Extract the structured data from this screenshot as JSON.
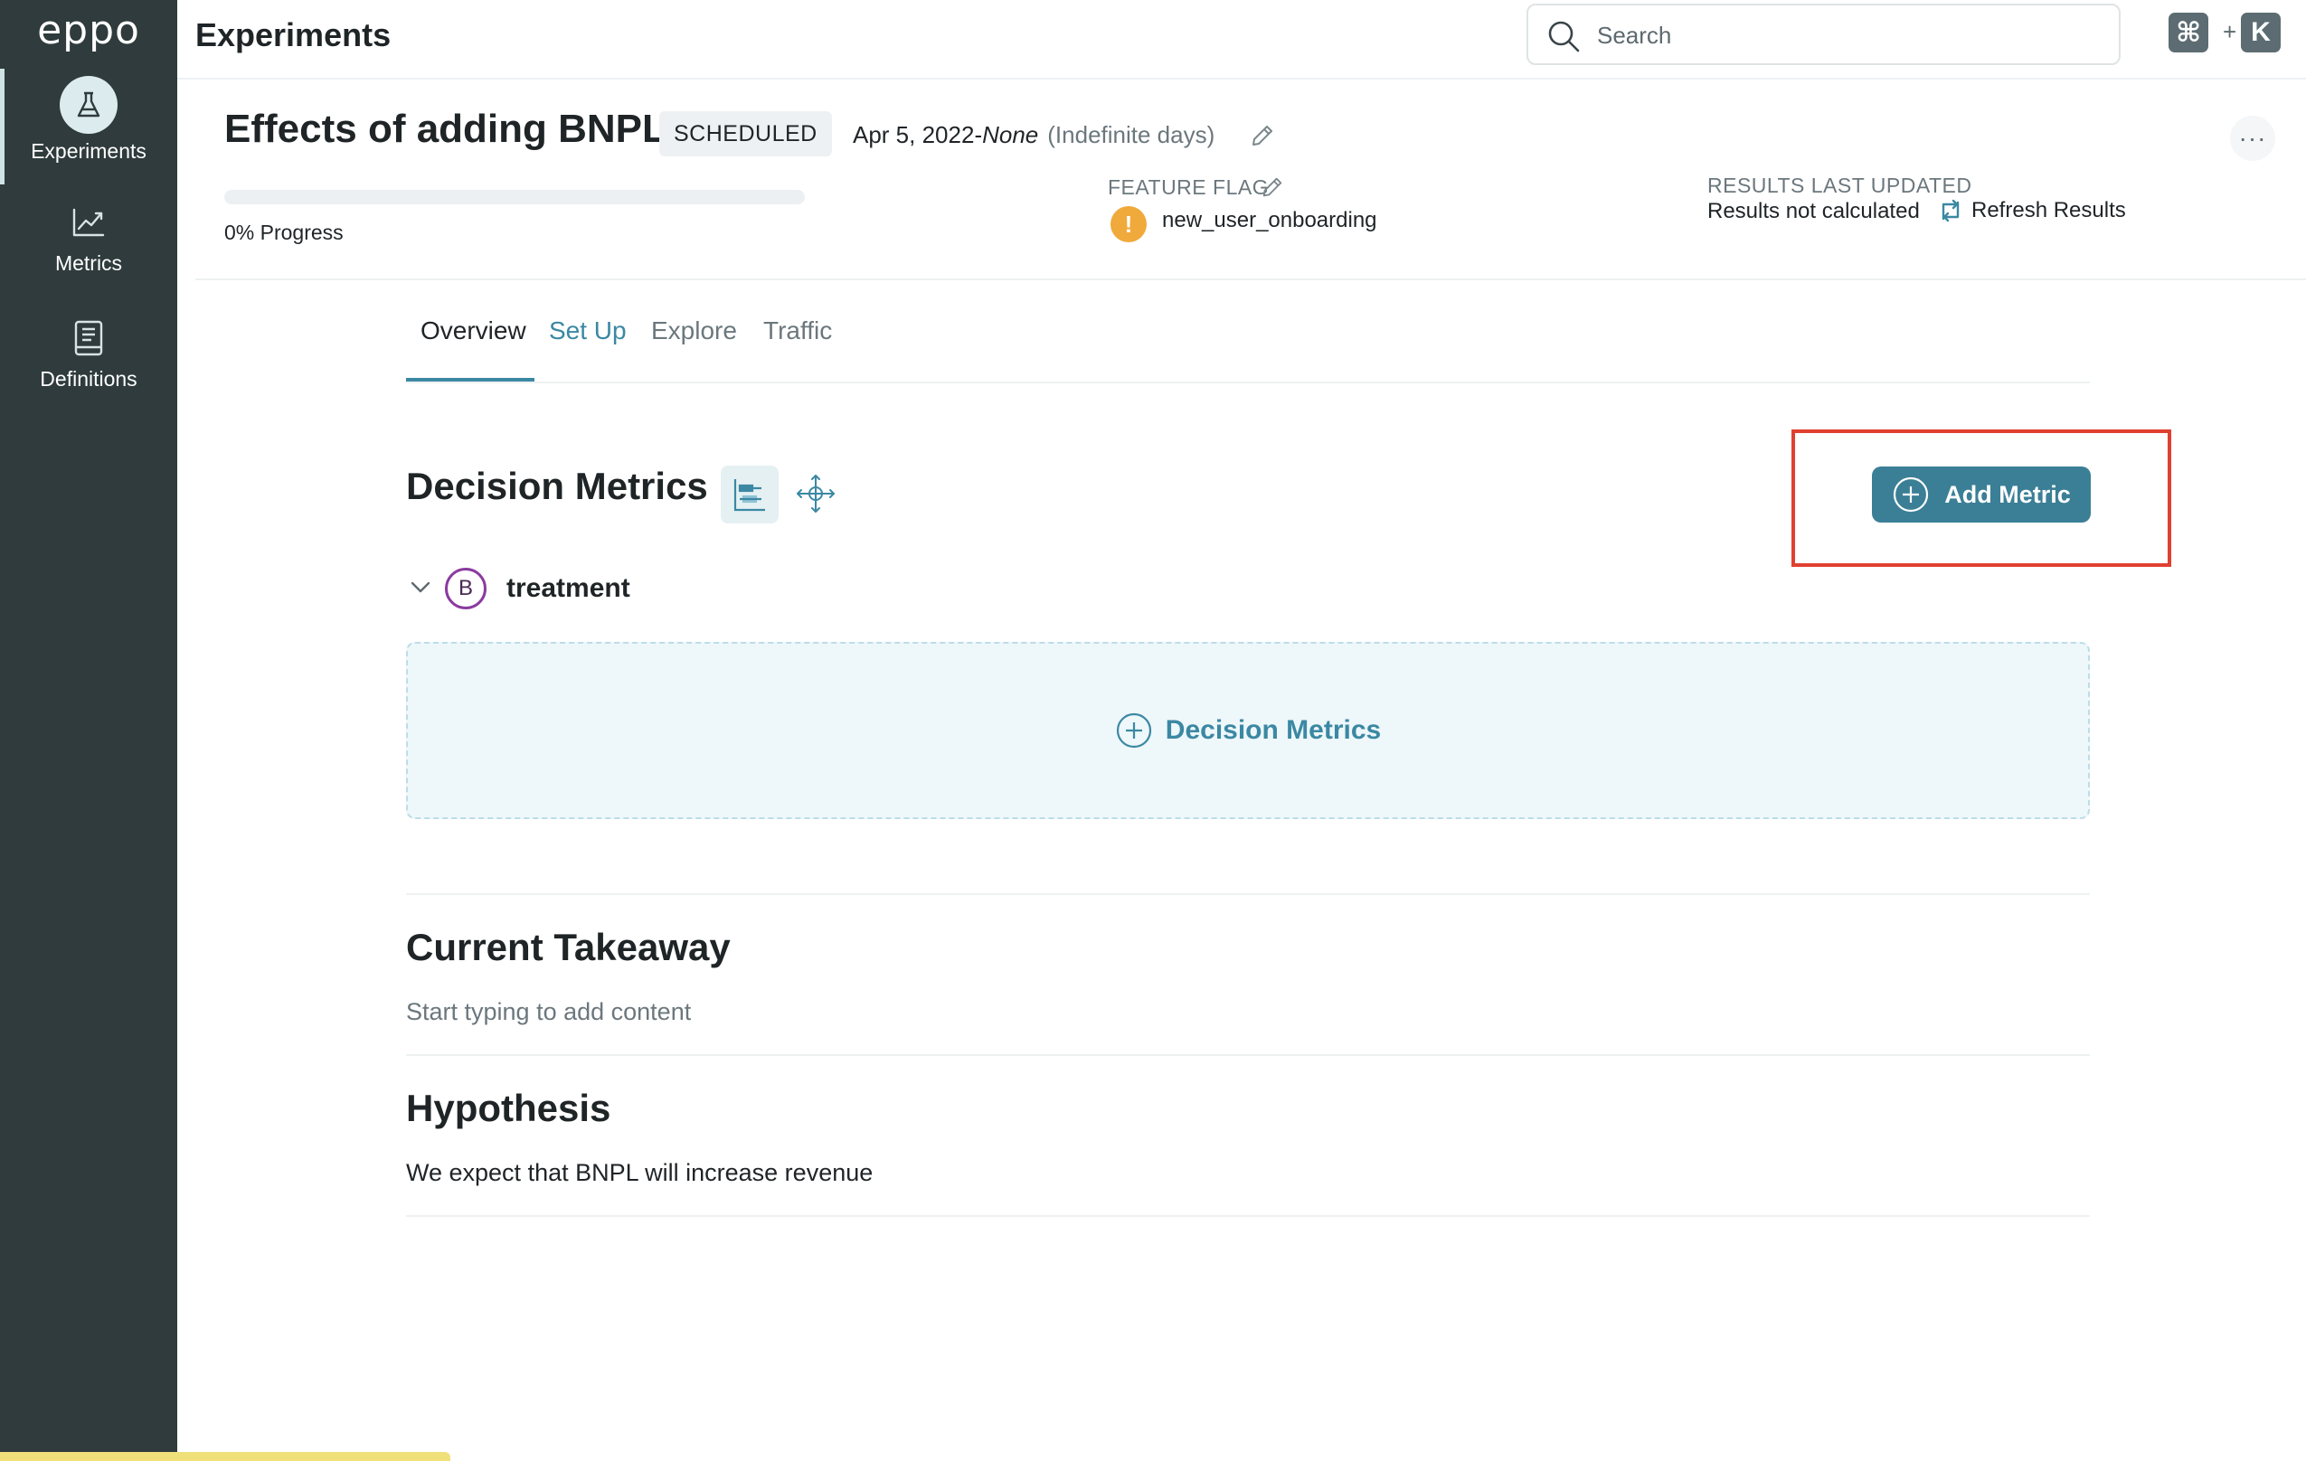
{
  "app": {
    "logo": "eppo",
    "page_title": "Experiments"
  },
  "sidebar": {
    "items": [
      {
        "label": "Experiments",
        "icon": "flask-icon",
        "active": true
      },
      {
        "label": "Metrics",
        "icon": "line-chart-icon",
        "active": false
      },
      {
        "label": "Definitions",
        "icon": "book-icon",
        "active": false
      }
    ]
  },
  "search": {
    "placeholder": "Search",
    "shortcut_modifier": "⌘",
    "shortcut_plus": "+",
    "shortcut_key": "K"
  },
  "experiment": {
    "title": "Effects of adding BNPL",
    "status_badge": "SCHEDULED",
    "start_date": "Apr 5, 2022",
    "date_separator": "-",
    "end_date": "None",
    "duration": "(Indefinite days)",
    "progress_percent": 0,
    "progress_label": "0% Progress",
    "feature_flag_label": "FEATURE FLAG",
    "feature_flag_value": "new_user_onboarding",
    "results_label": "RESULTS LAST UPDATED",
    "results_status": "Results not calculated",
    "refresh_label": "Refresh Results",
    "more_label": "···"
  },
  "tabs": [
    {
      "label": "Overview",
      "active": true
    },
    {
      "label": "Set Up",
      "active": false
    },
    {
      "label": "Explore",
      "active": false
    },
    {
      "label": "Traffic",
      "active": false
    }
  ],
  "decision_metrics": {
    "title": "Decision Metrics",
    "add_button": "Add Metric",
    "variant_letter": "B",
    "variant_name": "treatment",
    "empty_action": "Decision Metrics"
  },
  "takeaway": {
    "title": "Current Takeaway",
    "placeholder": "Start typing to add content"
  },
  "hypothesis": {
    "title": "Hypothesis",
    "text": "We expect that BNPL will increase revenue"
  },
  "colors": {
    "sidebar_bg": "#2f3b3c",
    "accent": "#3b88a3",
    "button_bg": "#3b7f96",
    "warning": "#f0a93b",
    "highlight_border": "#e04030",
    "variant_ring": "#8b3aa0"
  }
}
